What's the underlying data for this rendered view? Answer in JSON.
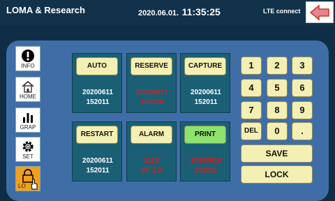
{
  "header": {
    "title": "LOMA & Research",
    "date": "2020.06.01.",
    "time": "11:35:25",
    "status": "LTE connect"
  },
  "icons": {
    "back": "back-arrow-icon",
    "info": "exclamation-icon",
    "home": "home-icon",
    "graph": "bar-chart-icon",
    "settings": "gear-icon",
    "lock": "padlock-icon",
    "pointer": "hand-pointer-icon"
  },
  "sidebar": {
    "info": "INFO",
    "home": "HOME",
    "graph": "GRAP",
    "set": "SET",
    "lock": "LO"
  },
  "cells": {
    "auto": {
      "label": "AUTO",
      "line1": "20200611",
      "line2": "152011"
    },
    "reserve": {
      "label": "RESERVE",
      "line1": "20200617",
      "line2": "162328"
    },
    "capture": {
      "label": "CAPTURE",
      "line1": "20200611",
      "line2": "152011"
    },
    "restart": {
      "label": "RESTART",
      "line1": "20200611",
      "line2": "152011"
    },
    "alarm": {
      "label": "ALARM",
      "line1": "1123'",
      "line2": "88' 2.0'"
    },
    "print": {
      "label": "PRINT",
      "line1": "20200610",
      "line2": "232011"
    }
  },
  "keypad": {
    "k1": "1",
    "k2": "2",
    "k3": "3",
    "k4": "4",
    "k5": "5",
    "k6": "6",
    "k7": "7",
    "k8": "8",
    "k9": "9",
    "del": "DEL",
    "k0": "0",
    "dot": ".",
    "save": "SAVE",
    "lock": "LOCK"
  },
  "colors": {
    "background": "#0f2e45",
    "panel": "#3f6ea7",
    "cell": "#1b5f75",
    "button": "#f4efb2",
    "print_button": "#8ee26e",
    "alert_text": "#e21a1a",
    "lock_active": "#f2a01c"
  }
}
